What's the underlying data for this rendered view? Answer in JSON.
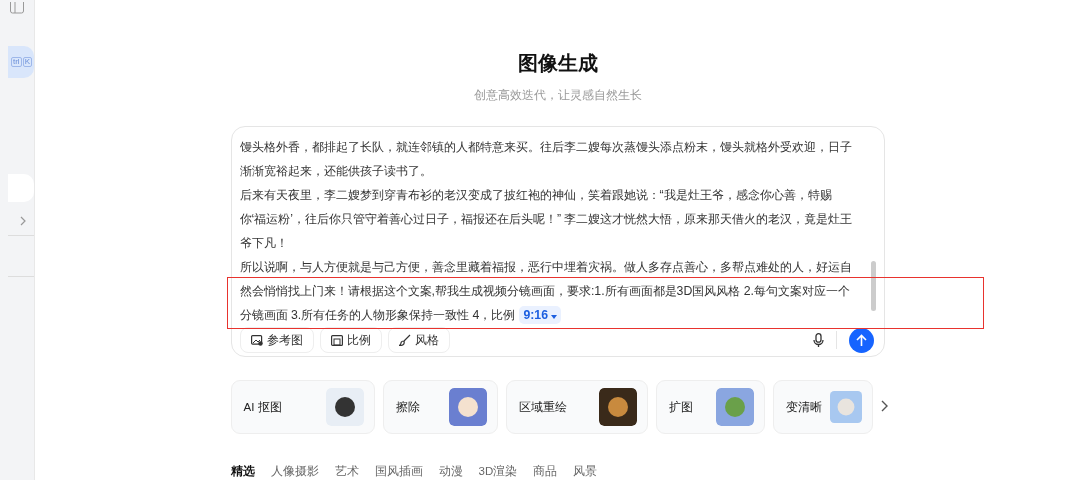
{
  "sidebar": {
    "shortcut_keys": [
      "trl",
      "K"
    ],
    "items": [
      {
        "kind": "blank",
        "selected": true
      },
      {
        "kind": "expander",
        "selected": false
      }
    ]
  },
  "header": {
    "title": "图像生成",
    "subtitle": "创意高效迭代，让灵感自然生长"
  },
  "prompt": {
    "paragraphs": [
      "馒头格外香，都排起了长队，就连邻镇的人都特意来买。往后李二嫂每次蒸馒头添点粉末，馒头就格外受欢迎，日子渐渐宽裕起来，还能供孩子读书了。",
      "后来有天夜里，李二嫂梦到穿青布衫的老汉变成了披红袍的神仙，笑着跟她说：“我是灶王爷，感念你心善，特赐你‘福运粉’，往后你只管守着善心过日子，福报还在后头呢！” 李二嫂这才恍然大悟，原来那天借火的老汉，竟是灶王爷下凡！",
      "所以说啊，与人方便就是与己方便，善念里藏着福报，恶行中埋着灾祸。做人多存点善心，多帮点难处的人，好运自然会悄悄找上门来！请根据这个文案,帮我生成视频分镜画面，要求:1.所有画面都是3D国风风格  2.每句文案对应一个分镜画面 3.所有任务的人物形象保持一致性 4，比例"
    ],
    "ratio_chip": "9:16",
    "highlighted": true,
    "tools": [
      {
        "kind": "image",
        "label": "参考图"
      },
      {
        "kind": "ratio",
        "label": "比例"
      },
      {
        "kind": "style",
        "label": "风格"
      }
    ]
  },
  "feature_cards": [
    {
      "label": "AI 抠图",
      "kind": "headphones"
    },
    {
      "label": "擦除",
      "kind": "photo"
    },
    {
      "label": "区域重绘",
      "kind": "dog"
    },
    {
      "label": "扩图",
      "kind": "landscape"
    },
    {
      "label": "变清晰",
      "kind": "portrait"
    }
  ],
  "categories": [
    {
      "label": "精选",
      "selected": true
    },
    {
      "label": "人像摄影",
      "selected": false
    },
    {
      "label": "艺术",
      "selected": false
    },
    {
      "label": "国风插画",
      "selected": false
    },
    {
      "label": "动漫",
      "selected": false
    },
    {
      "label": "3D渲染",
      "selected": false
    },
    {
      "label": "商品",
      "selected": false
    },
    {
      "label": "风景",
      "selected": false
    }
  ]
}
